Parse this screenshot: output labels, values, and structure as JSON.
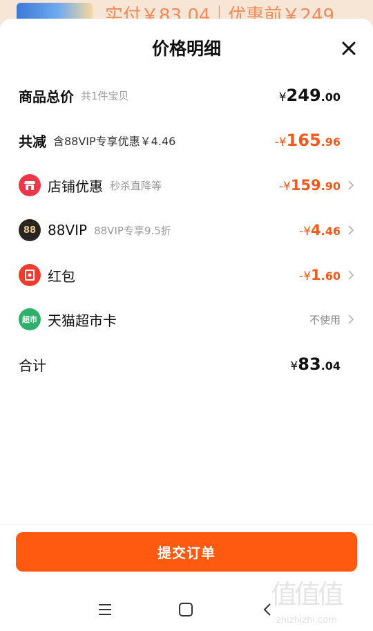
{
  "background": {
    "strip_text": "实付￥83.04｜优惠前￥249"
  },
  "header": {
    "title": "价格明细"
  },
  "rows": {
    "total_price": {
      "label": "商品总价",
      "sub": "共1件宝贝",
      "sign": "¥",
      "int": "249",
      "dec": ".00"
    },
    "total_discount": {
      "label": "共减",
      "sub": "含88VIP专享优惠￥4.46",
      "sign": "-¥",
      "int": "165",
      "dec": ".96"
    },
    "shop_discount": {
      "label": "店铺优惠",
      "sub": "秒杀直降等",
      "sign": "-¥",
      "int": "159",
      "dec": ".90",
      "icon": "shop-icon"
    },
    "vip": {
      "label": "88VIP",
      "sub": "88VIP专享9.5折",
      "sign": "-¥",
      "int": "4",
      "dec": ".46",
      "icon": "vip-88-icon",
      "icon_text": "88"
    },
    "red_packet": {
      "label": "红包",
      "sign": "-¥",
      "int": "1",
      "dec": ".60",
      "icon": "red-packet-icon"
    },
    "tmall_card": {
      "label": "天猫超市卡",
      "status": "不使用",
      "icon": "tmall-supermarket-icon",
      "icon_text": "超市"
    },
    "sum": {
      "label": "合计",
      "sign": "¥",
      "int": "83",
      "dec": ".04"
    }
  },
  "footer": {
    "submit_label": "提交订单"
  },
  "watermark": {
    "glyphs": "值值值",
    "domain": "zhizhizhi.com"
  },
  "colors": {
    "accent": "#ff5a10",
    "price_orange": "#f05a1c",
    "shop_icon": "#f0374a",
    "vip_icon": "#2b2522",
    "red_packet_icon": "#f03c2e",
    "tmall_icon": "#2fb06a"
  }
}
